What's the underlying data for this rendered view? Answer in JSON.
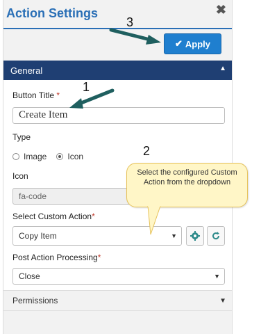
{
  "header": {
    "title": "Action Settings",
    "close_label": "✖"
  },
  "toolbar": {
    "apply_label": "Apply"
  },
  "general_section": {
    "label": "General",
    "button_title": {
      "label": "Button Title",
      "required_mark": "*",
      "value": "Create Item"
    },
    "type": {
      "label": "Type",
      "options": [
        {
          "label": "Image",
          "checked": false
        },
        {
          "label": "Icon",
          "checked": true
        }
      ]
    },
    "icon": {
      "label": "Icon",
      "value": "fa-code"
    },
    "custom_action": {
      "label": "Select Custom Action",
      "required_mark": "*",
      "value": "Copy Item"
    },
    "post_action": {
      "label": "Post Action Processing",
      "required_mark": "*",
      "value": "Close"
    }
  },
  "permissions": {
    "label": "Permissions"
  },
  "annotations": {
    "n1": "1",
    "n2": "2",
    "n3": "3",
    "callout_text": "Select the configured Custom Action from the dropdown"
  },
  "colors": {
    "accent": "#2a6fb6",
    "section_bar": "#1f3f73",
    "apply_button": "#1f7fcf",
    "callout_fill": "#fff6c7",
    "arrow": "#1f5f5f"
  }
}
